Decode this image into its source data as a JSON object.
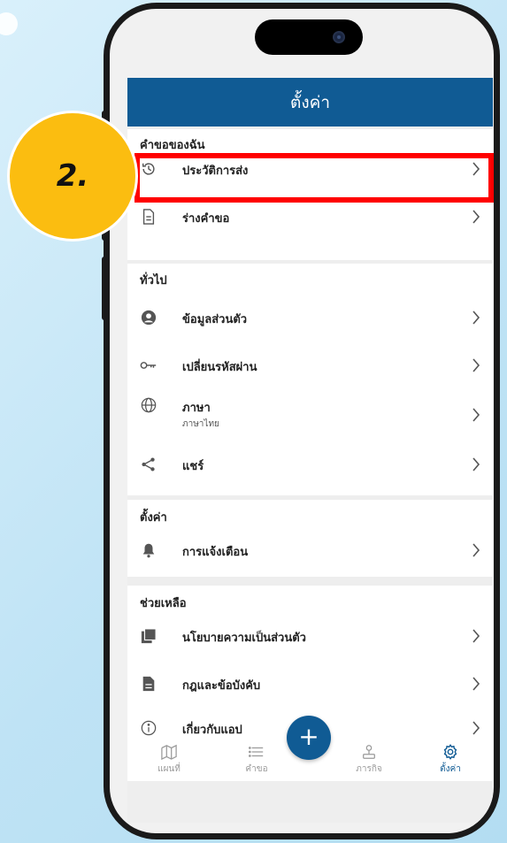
{
  "header": {
    "title": "ตั้งค่า"
  },
  "sections": {
    "my_requests": {
      "title": "คำขอของฉัน",
      "items": [
        {
          "label": "ประวัติการส่ง",
          "icon": "history-icon"
        },
        {
          "label": "ร่างคำขอ",
          "icon": "document-icon"
        }
      ]
    },
    "general": {
      "title": "ทั่วไป",
      "items": [
        {
          "label": "ข้อมูลส่วนตัว",
          "icon": "user-icon"
        },
        {
          "label": "เปลี่ยนรหัสผ่าน",
          "icon": "key-icon"
        },
        {
          "label": "ภาษา",
          "sublabel": "ภาษาไทย",
          "icon": "globe-icon"
        },
        {
          "label": "แชร์",
          "icon": "share-icon"
        }
      ]
    },
    "settings": {
      "title": "ตั้งค่า",
      "items": [
        {
          "label": "การแจ้งเตือน",
          "icon": "bell-icon"
        }
      ]
    },
    "help": {
      "title": "ช่วยเหลือ",
      "items": [
        {
          "label": "นโยบายความเป็นส่วนตัว",
          "icon": "privacy-icon"
        },
        {
          "label": "กฎและข้อบังคับ",
          "icon": "rules-icon"
        },
        {
          "label": "เกี่ยวกับแอป",
          "icon": "info-icon"
        }
      ]
    }
  },
  "bottom_nav": {
    "items": [
      {
        "label": "แผนที่",
        "icon": "map-icon",
        "active": false
      },
      {
        "label": "คำขอ",
        "icon": "list-icon",
        "active": false
      },
      {
        "label": "ภารกิจ",
        "icon": "mission-icon",
        "active": false
      },
      {
        "label": "ตั้งค่า",
        "icon": "gear-icon",
        "active": true
      }
    ],
    "fab_label": "+"
  },
  "annotation": {
    "step_label": "2."
  },
  "colors": {
    "primary": "#105b94",
    "badge": "#fbbd10",
    "highlight": "#ff0000",
    "icon": "#555555"
  }
}
